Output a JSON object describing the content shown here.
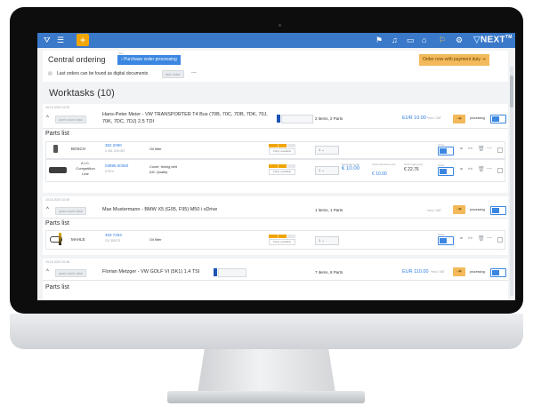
{
  "topbar": {
    "brand": "NEXT",
    "brand_sup": "TM",
    "plus_label": "+"
  },
  "header": {
    "title": "Central ordering",
    "badge_label": "new",
    "purchase_button": "Purchase order processing",
    "order_now_button": "Order now with payment duty",
    "digital_note": "Last orders can be found as digital documents",
    "last_order_chip": "last order",
    "more": "..."
  },
  "worktasks": {
    "heading": "Worktasks (10)",
    "items": [
      {
        "date": "15.10.2020 12:02",
        "status_chip": "open work task",
        "title_line1": "Hans-Peter Meier - VW TRANSPORTER T4 Bus (70B, 70C, 7DB, 7DK, 70J,",
        "title_line2": "70K, 7DC, 7DJ) 2.5 TDI",
        "summary": "2 items, 2 Parts",
        "price": "EUR 10.00",
        "price_note": "*excl. VAT",
        "state": "processing",
        "parts_label": "Parts list",
        "parts": [
          {
            "brand": "BOSCH",
            "number": "382 2090",
            "sub": "0 451 203 087",
            "desc": "Oil filter",
            "desc2": "",
            "stock": "Partly available",
            "qty": "1",
            "purchase_label": "",
            "purchase": "",
            "total_label": "",
            "total": "",
            "order_label": "Order"
          },
          {
            "brand": "A.I.C. Competition Line",
            "number": "03895.00360",
            "sub": "57574",
            "desc": "Cover, timing belt",
            "desc2": "AIC Quality",
            "stock": "Partly available",
            "qty": "1",
            "purchase_label": "Purchase price",
            "purchase": "€ 10.00",
            "total_label": "Total purchase price",
            "total": "€ 10.00",
            "retail_label": "Total retail price",
            "retail": "€ 22.76",
            "order_label": "Order"
          }
        ]
      },
      {
        "date": "15.10.2020 10:49",
        "status_chip": "open work task",
        "title_line1": "Max Mustermann - BMW X5 (G05, F95) M50 i xDrive",
        "summary": "1 items, 1 Parts",
        "price": "",
        "price_note": "*excl. VAT",
        "state": "processing",
        "parts_label": "Parts list",
        "parts": [
          {
            "brand": "MAHLE",
            "number": "463 7453",
            "sub": "OX 353/7D",
            "desc": "Oil filter",
            "stock": "Partly available",
            "qty": "1",
            "order_label": "Order"
          }
        ]
      },
      {
        "date": "15.10.2020 10:46",
        "status_chip": "open work task",
        "title_line1": "Florian Metzger - VW GOLF VI (5K1) 1.4 TSI",
        "summary": "7 items, 8 Parts",
        "price": "EUR 110.00",
        "price_note": "*excl. VAT",
        "state": "processing",
        "parts_label": "Parts list"
      }
    ]
  },
  "colors": {
    "accent": "#3a78c9",
    "orange": "#f3b95a",
    "plus": "#f0a500"
  }
}
